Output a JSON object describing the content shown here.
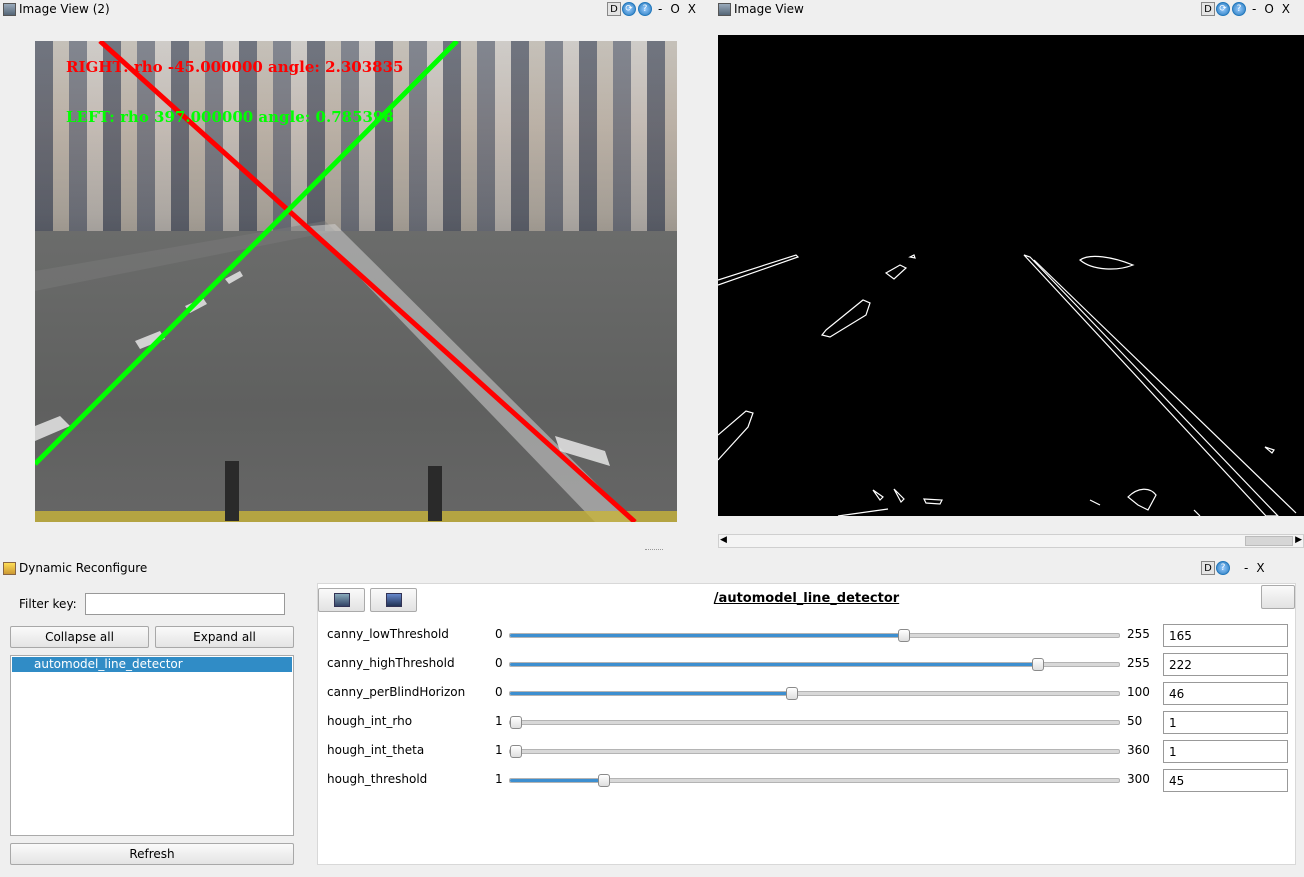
{
  "image_view_left": {
    "title": "Image View (2)",
    "controls": [
      "D",
      "-",
      "O",
      "X"
    ],
    "overlay_right": "RIGHT: rho -45.000000 angle: 2.303835",
    "overlay_left": "LEFT: rho 397.000000 angle: 0.785398",
    "colors": {
      "right_line": "#ff0000",
      "left_line": "#00ff00"
    }
  },
  "image_view_right": {
    "title": "Image View",
    "controls": [
      "D",
      "-",
      "O",
      "X"
    ]
  },
  "dynamic_reconfigure": {
    "title": "Dynamic Reconfigure",
    "controls": [
      "D",
      "-",
      "X"
    ],
    "filter_label": "Filter key:",
    "filter_value": "",
    "collapse_label": "Collapse all",
    "expand_label": "Expand all",
    "tree_items": [
      "automodel_line_detector"
    ],
    "refresh_label": "Refresh",
    "node_name": "/automodel_line_detector",
    "params": [
      {
        "name": "canny_lowThreshold",
        "min": "0",
        "max": "255",
        "value": "165",
        "fraction": 0.647
      },
      {
        "name": "canny_highThreshold",
        "min": "0",
        "max": "255",
        "value": "222",
        "fraction": 0.871
      },
      {
        "name": "canny_perBlindHorizon",
        "min": "0",
        "max": "100",
        "value": "46",
        "fraction": 0.46
      },
      {
        "name": "hough_int_rho",
        "min": "1",
        "max": "50",
        "value": "1",
        "fraction": 0.0
      },
      {
        "name": "hough_int_theta",
        "min": "1",
        "max": "360",
        "value": "1",
        "fraction": 0.0
      },
      {
        "name": "hough_threshold",
        "min": "1",
        "max": "300",
        "value": "45",
        "fraction": 0.147
      }
    ]
  }
}
